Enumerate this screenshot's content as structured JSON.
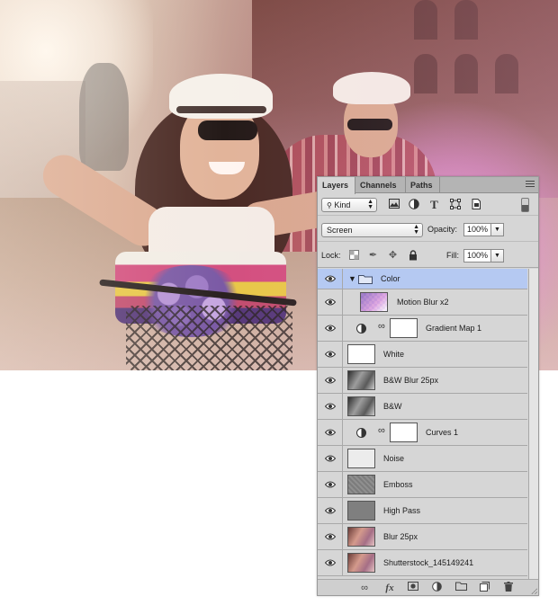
{
  "panel": {
    "tabs": [
      {
        "label": "Layers",
        "active": true
      },
      {
        "label": "Channels",
        "active": false
      },
      {
        "label": "Paths",
        "active": false
      }
    ],
    "filter": {
      "kind_label": "Kind",
      "filter_icons": [
        "image-filter-icon",
        "adjustment-filter-icon",
        "type-filter-icon",
        "shape-filter-icon",
        "smart-object-filter-icon"
      ]
    },
    "blend_mode": "Screen",
    "opacity_label": "Opacity:",
    "opacity_value": "100%",
    "lock_label": "Lock:",
    "fill_label": "Fill:",
    "fill_value": "100%",
    "layers": [
      {
        "name": "Color",
        "type": "group",
        "visible": true,
        "expanded": true
      },
      {
        "name": "Motion Blur x2",
        "type": "pixel",
        "visible": true,
        "indented": true
      },
      {
        "name": "Gradient Map 1",
        "type": "adjustment",
        "visible": true,
        "indented": true
      },
      {
        "name": "White",
        "type": "pixel",
        "visible": true
      },
      {
        "name": "B&W Blur 25px",
        "type": "pixel",
        "visible": true
      },
      {
        "name": "B&W",
        "type": "pixel",
        "visible": true
      },
      {
        "name": "Curves 1",
        "type": "adjustment",
        "visible": true,
        "indented": true
      },
      {
        "name": "Noise",
        "type": "pixel",
        "visible": true
      },
      {
        "name": "Emboss",
        "type": "pixel",
        "visible": true
      },
      {
        "name": "High Pass",
        "type": "pixel",
        "visible": true
      },
      {
        "name": "Blur 25px",
        "type": "pixel",
        "visible": true
      },
      {
        "name": "Shutterstock_145149241",
        "type": "pixel",
        "visible": true
      }
    ],
    "footer_icons": [
      "link-layers-icon",
      "fx-icon",
      "add-mask-icon",
      "new-adjustment-icon",
      "new-group-icon",
      "new-layer-icon",
      "trash-icon"
    ],
    "colors": {
      "panel_bg": "#d6d6d6",
      "selected_group": "#b5c9f2",
      "tab_bar": "#b4b4b4"
    }
  }
}
